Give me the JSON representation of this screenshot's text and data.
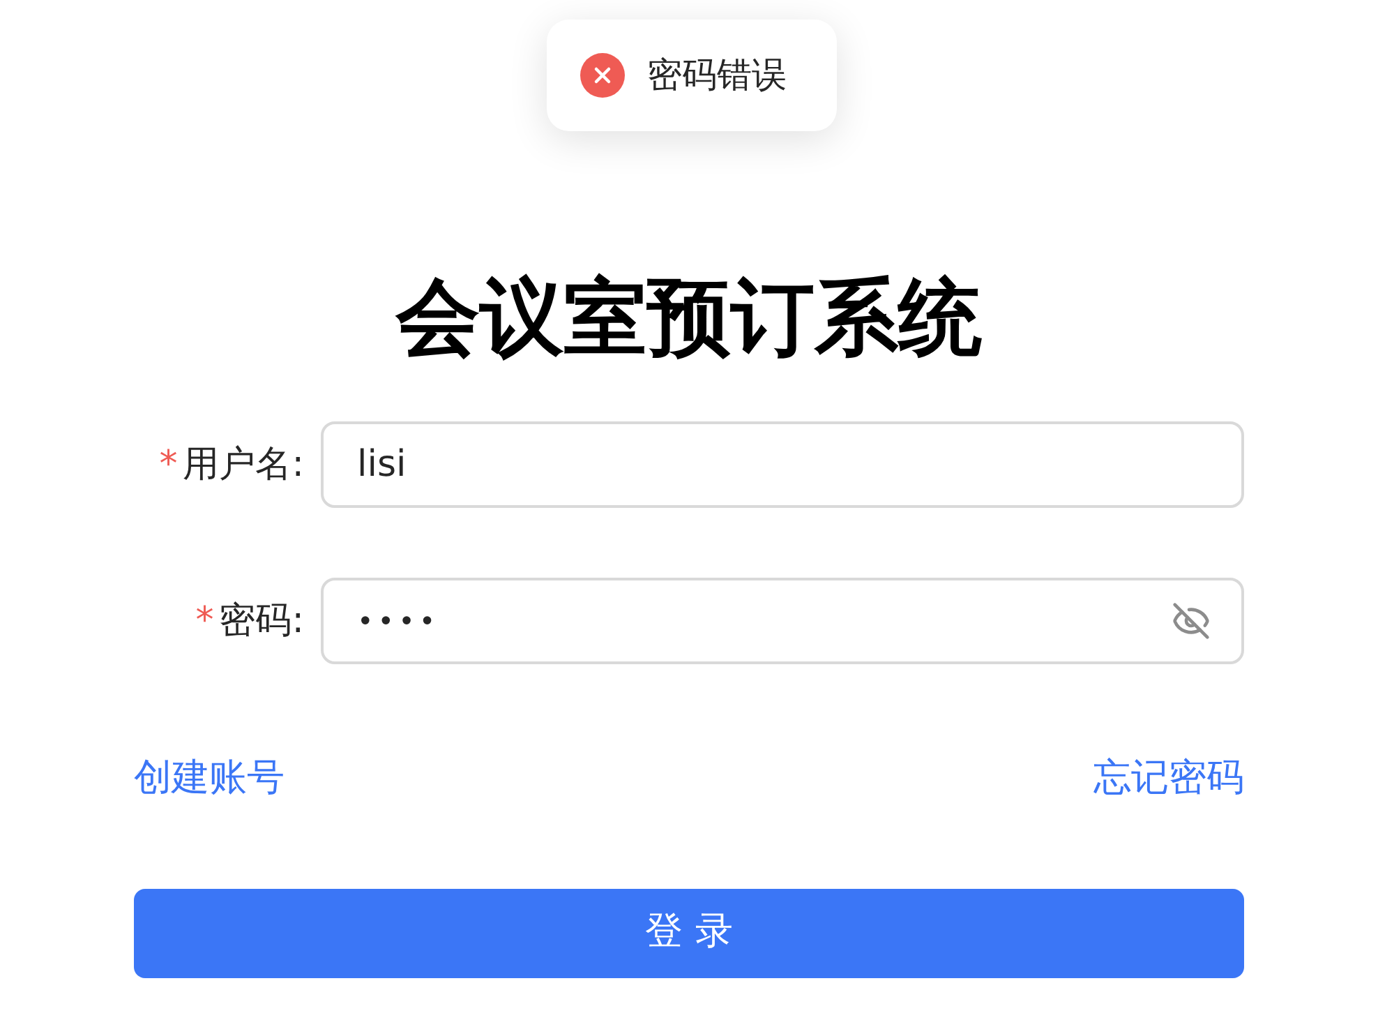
{
  "toast": {
    "kind": "error",
    "message": "密码错误"
  },
  "title": "会议室预订系统",
  "fields": [
    {
      "label": "用户名",
      "colon": ":",
      "required": true,
      "required_mark": "*",
      "value": "lisi",
      "kind": "text"
    },
    {
      "label": "密码",
      "colon": ":",
      "required": true,
      "required_mark": "*",
      "value": "••••",
      "kind": "password"
    }
  ],
  "links": [
    "创建账号",
    "忘记密码"
  ],
  "submit": "登 录"
}
